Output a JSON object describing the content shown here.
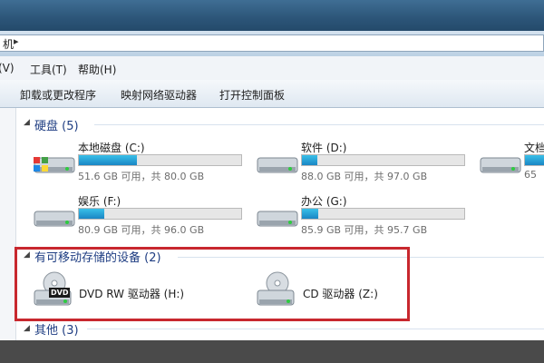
{
  "address": {
    "path": "机",
    "arrow": "▸"
  },
  "menu": {
    "view": "(V)",
    "tools": "工具(T)",
    "help": "帮助(H)"
  },
  "toolbar": {
    "uninstall": "卸载或更改程序",
    "map_drive": "映射网络驱动器",
    "control_panel": "打开控制面板"
  },
  "groups": {
    "hard_disks": {
      "title": "硬盘 (5)",
      "arrow": "◢"
    },
    "removable": {
      "title": "有可移动存储的设备 (2)",
      "arrow": "◢"
    },
    "other": {
      "title": "其他 (3)",
      "arrow": "◢"
    }
  },
  "drives": [
    {
      "name": "本地磁盘 (C:)",
      "space": "51.6 GB 可用，共 80.0 GB",
      "used_fraction": 0.355
    },
    {
      "name": "软件 (D:)",
      "space": "88.0 GB 可用，共 97.0 GB",
      "used_fraction": 0.093
    },
    {
      "name": "文档",
      "space": "65",
      "used_fraction": 0.3
    },
    {
      "name": "娱乐 (F:)",
      "space": "80.9 GB 可用，共 96.0 GB",
      "used_fraction": 0.157
    },
    {
      "name": "办公 (G:)",
      "space": "85.9 GB 可用，共 95.7 GB",
      "used_fraction": 0.102
    }
  ],
  "removable_drives": [
    {
      "name": "DVD RW 驱动器 (H:)",
      "badge": "DVD"
    },
    {
      "name": "CD 驱动器 (Z:)"
    }
  ],
  "colors": {
    "group_header": "#1e3d82",
    "highlight": "#c8282e",
    "bar_fill": "#1a86c4"
  }
}
